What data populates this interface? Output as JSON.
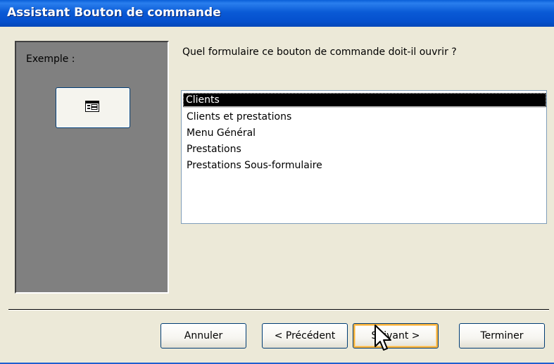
{
  "window": {
    "title": "Assistant Bouton de commande"
  },
  "example": {
    "label": "Exemple :",
    "button_icon": "form-icon"
  },
  "question": "Quel formulaire ce bouton de commande doit-il ouvrir ?",
  "forms_list": {
    "items": [
      "Clients",
      "Clients et prestations",
      "Menu Général",
      "Prestations",
      "Prestations Sous-formulaire"
    ],
    "selected": "Clients"
  },
  "buttons": {
    "cancel": "Annuler",
    "previous": "< Précédent",
    "next": "Suivant >",
    "finish": "Terminer"
  },
  "colors": {
    "titlebar": "#0a5ad6",
    "dialog_bg": "#ece9d8",
    "example_panel": "#808080",
    "selection": "#000000",
    "focus_ring": "#f8b13a"
  },
  "cursor_icon": "arrow-cursor-icon"
}
